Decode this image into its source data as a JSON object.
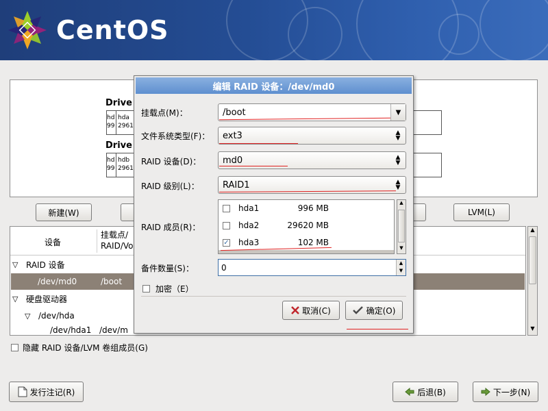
{
  "brand": {
    "name": "CentOS"
  },
  "drives": [
    {
      "label": "Drive",
      "cell1": [
        "hd",
        "99"
      ],
      "cell2": [
        "hda",
        "2961"
      ]
    },
    {
      "label": "Drive",
      "cell1": [
        "hd",
        "99"
      ],
      "cell2": [
        "hdb",
        "2961"
      ]
    }
  ],
  "buttons": {
    "new": "新建(W)",
    "new_key": "W",
    "lvm": "LVM(L)",
    "lvm_key": "L",
    "notes": "发行注记(R)",
    "notes_key": "R",
    "back": "后退(B)",
    "back_key": "B",
    "next": "下一步(N)",
    "next_key": "N"
  },
  "table": {
    "col_device": "设备",
    "col_mount_line1": "挂载点/",
    "col_mount_line2": "RAID/Vo",
    "rows": [
      {
        "indent": 0,
        "expander": "▽",
        "device": "RAID 设备",
        "mount": ""
      },
      {
        "indent": 1,
        "expander": "",
        "device": "/dev/md0",
        "mount": "/boot",
        "selected": true
      },
      {
        "indent": 0,
        "expander": "▽",
        "device": "硬盘驱动器",
        "mount": ""
      },
      {
        "indent": 1,
        "expander": "▽",
        "device": "/dev/hda",
        "mount": ""
      },
      {
        "indent": 2,
        "expander": "",
        "device": "/dev/hda1",
        "mount": "/dev/m"
      }
    ]
  },
  "hide_raid_checkbox": {
    "label": "隐藏 RAID 设备/LVM 卷组成员(G)",
    "checked": false
  },
  "dialog": {
    "title": "编辑 RAID 设备：/dev/md0",
    "mount_label": "挂载点(M)：",
    "mount_value": "/boot",
    "fstype_label": "文件系统类型(F)：",
    "fstype_value": "ext3",
    "raid_device_label": "RAID 设备(D)：",
    "raid_device_value": "md0",
    "raid_level_label": "RAID 级别(L)：",
    "raid_level_value": "RAID1",
    "members_label": "RAID 成员(R)：",
    "members": [
      {
        "name": "hda1",
        "size": "996 MB",
        "checked": false
      },
      {
        "name": "hda2",
        "size": "29620 MB",
        "checked": false
      },
      {
        "name": "hda3",
        "size": "102 MB",
        "checked": true
      }
    ],
    "spares_label": "备件数量(S)：",
    "spares_value": "0",
    "encrypt_label": "加密（E）",
    "encrypt_checked": false,
    "cancel": "取消(C)",
    "ok": "确定(O)"
  },
  "colors": {
    "selection": "#8c8176",
    "title_bar": "#5e8fcf",
    "annotation": "#e02020",
    "banner": "#244d94"
  }
}
